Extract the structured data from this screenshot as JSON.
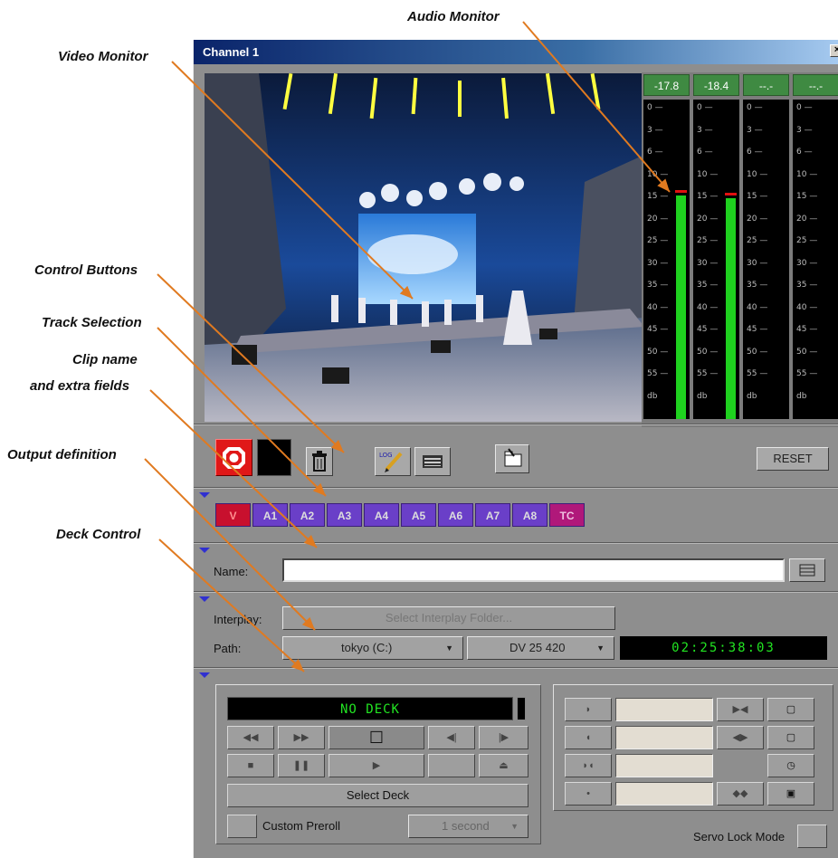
{
  "callouts": {
    "audio_monitor": "Audio Monitor",
    "video_monitor": "Video Monitor",
    "control_buttons": "Control Buttons",
    "track_selection": "Track Selection",
    "clip_name_1": "Clip name",
    "clip_name_2": "and extra fields",
    "output_definition": "Output definition",
    "deck_control": "Deck Control"
  },
  "colors": {
    "callout_line": "#e07a20",
    "meter_green": "#1fd11f",
    "timecode_green": "#22e422",
    "track_purple": "#6a3fc8",
    "record_red": "#e01818"
  },
  "window": {
    "title": "Channel 1",
    "close_label": "×"
  },
  "meters": {
    "readouts": [
      "-17.8",
      "-18.4",
      "--.-",
      "--.-"
    ],
    "scale": [
      "0",
      "3",
      "6",
      "10",
      "15",
      "20",
      "25",
      "30",
      "35",
      "40",
      "45",
      "50",
      "55",
      "db"
    ],
    "levels": [
      0.72,
      0.71,
      0,
      0
    ]
  },
  "controls": {
    "reset_label": "RESET",
    "log_label": "LOG",
    "icons": [
      "record-icon",
      "trash-icon",
      "log-pencil-icon",
      "clip-settings-icon",
      "folder-icon"
    ]
  },
  "tracks": [
    "V",
    "A1",
    "A2",
    "A3",
    "A4",
    "A5",
    "A6",
    "A7",
    "A8",
    "TC"
  ],
  "clip": {
    "name_label": "Name:",
    "name_value": ""
  },
  "output": {
    "interplay_label": "Interplay:",
    "interplay_button": "Select Interplay Folder...",
    "path_label": "Path:",
    "drive": "tokyo (C:)",
    "resolution": "DV 25 420",
    "timecode": "02:25:38:03"
  },
  "deck": {
    "status": "NO DECK",
    "select_deck": "Select Deck",
    "custom_preroll": "Custom Preroll",
    "preroll_value": "1 second",
    "servo_lock": "Servo Lock Mode"
  }
}
